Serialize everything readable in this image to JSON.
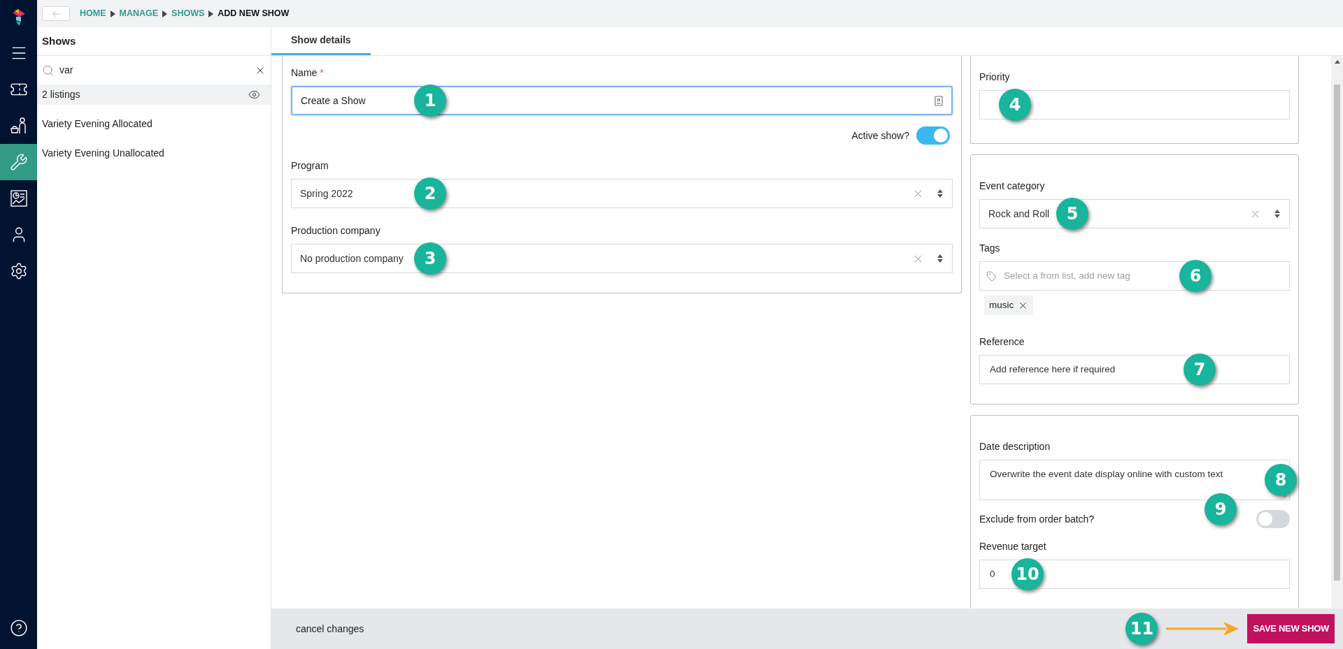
{
  "nav": [
    {
      "kind": "logo",
      "selected": false
    },
    {
      "kind": "menu",
      "selected": false
    },
    {
      "kind": "ticket",
      "selected": false
    },
    {
      "kind": "customers",
      "selected": false
    },
    {
      "kind": "wrench",
      "selected": true
    },
    {
      "kind": "report",
      "selected": false
    },
    {
      "kind": "user",
      "selected": false
    },
    {
      "kind": "settings",
      "selected": false
    },
    {
      "kind": "help",
      "selected": false
    }
  ],
  "breadcrumb": [
    {
      "label": "HOME",
      "current": false
    },
    {
      "label": "MANAGE",
      "current": false
    },
    {
      "label": "SHOWS",
      "current": false
    },
    {
      "label": "ADD NEW SHOW",
      "current": true
    }
  ],
  "shows_panel": {
    "title": "Shows",
    "search": {
      "value": "var"
    },
    "count": "2 listings",
    "items": [
      {
        "label": "Variety Evening Allocated"
      },
      {
        "label": "Variety Evening Unallocated"
      }
    ]
  },
  "tabs": [
    {
      "label": "Show details",
      "selected": true
    }
  ],
  "form": {
    "name": {
      "label": "Name",
      "required_mark": "*",
      "value": "Create a Show",
      "callout": "1"
    },
    "active_show": {
      "label": "Active show?",
      "on": true
    },
    "program": {
      "label": "Program",
      "value": "Spring 2022",
      "callout": "2"
    },
    "production_company": {
      "label": "Production company",
      "value": "No production company",
      "callout": "3"
    }
  },
  "side": {
    "priority": {
      "label": "Priority",
      "callout": "4"
    },
    "event_category": {
      "label": "Event category",
      "value": "Rock and Roll",
      "callout": "5"
    },
    "tags": {
      "label": "Tags",
      "placeholder": "Select a from list, add new tag",
      "chips": [
        "music"
      ],
      "callout": "6"
    },
    "reference": {
      "label": "Reference",
      "value": "Add reference here if required",
      "callout": "7"
    },
    "date_description": {
      "label": "Date description",
      "value": "Overwrite the event date display online with custom text",
      "callout": "8"
    },
    "exclude_from_order_batch": {
      "label": "Exclude from order batch?",
      "on": false,
      "callout": "9"
    },
    "revenue_target": {
      "label": "Revenue target",
      "value": "0",
      "callout": "10"
    }
  },
  "footer": {
    "cancel": "cancel changes",
    "save": {
      "label": "SAVE NEW SHOW",
      "callout": "11"
    }
  }
}
